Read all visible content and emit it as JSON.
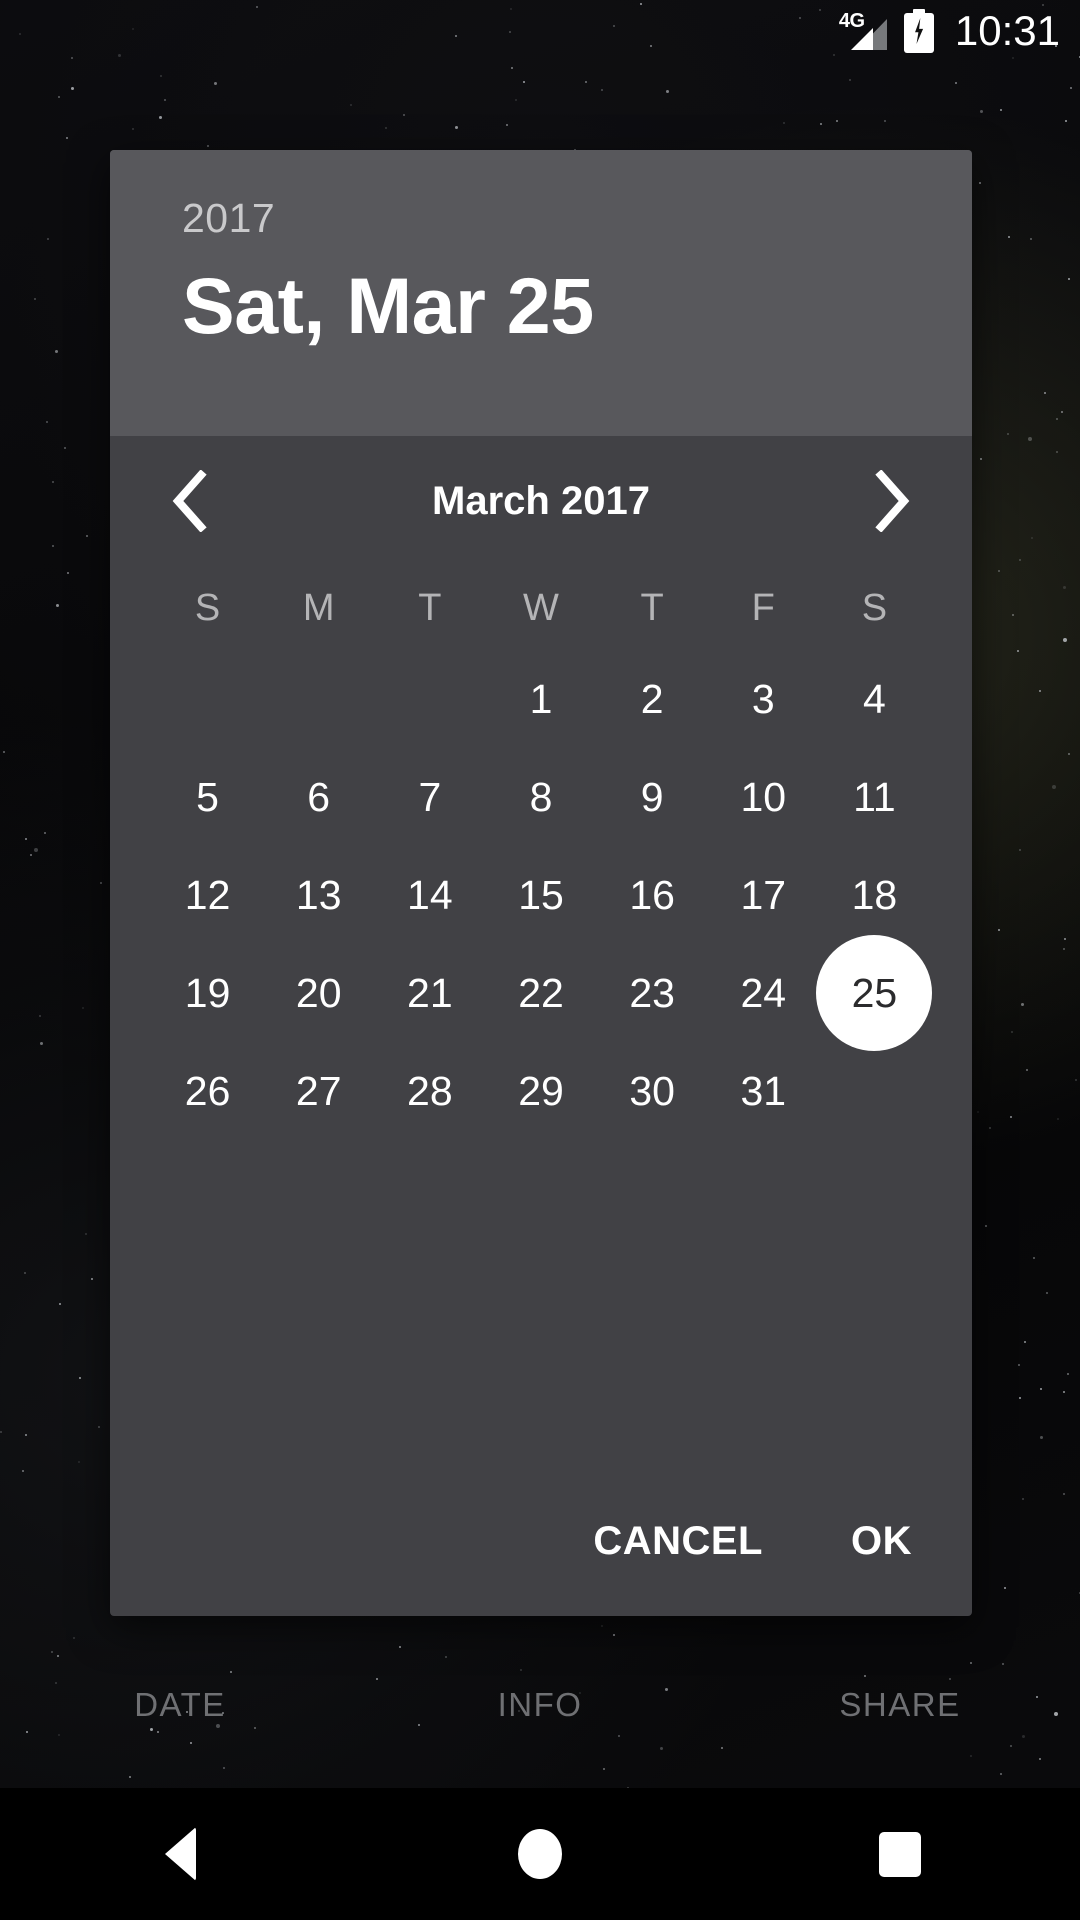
{
  "status_bar": {
    "network_label": "4G",
    "time": "10:31",
    "battery_icon": "battery-charging-icon",
    "signal_icon": "signal-bars-icon"
  },
  "dialog": {
    "header": {
      "year": "2017",
      "date_line": "Sat, Mar 25"
    },
    "month_nav": {
      "prev_icon": "chevron-left-icon",
      "next_icon": "chevron-right-icon",
      "month_label": "March 2017"
    },
    "weekday_headers": [
      "S",
      "M",
      "T",
      "W",
      "T",
      "F",
      "S"
    ],
    "weeks": [
      [
        "",
        "",
        "",
        "1",
        "2",
        "3",
        "4"
      ],
      [
        "5",
        "6",
        "7",
        "8",
        "9",
        "10",
        "11"
      ],
      [
        "12",
        "13",
        "14",
        "15",
        "16",
        "17",
        "18"
      ],
      [
        "19",
        "20",
        "21",
        "22",
        "23",
        "24",
        "25"
      ],
      [
        "26",
        "27",
        "28",
        "29",
        "30",
        "31",
        ""
      ]
    ],
    "selected_day": "25",
    "actions": {
      "cancel_label": "CANCEL",
      "ok_label": "OK"
    }
  },
  "bottom_tabs": [
    {
      "label": "DATE"
    },
    {
      "label": "INFO"
    },
    {
      "label": "SHARE"
    }
  ],
  "nav_bar": {
    "back_icon": "back-triangle-icon",
    "home_icon": "home-circle-icon",
    "recents_icon": "recents-square-icon"
  },
  "colors": {
    "dialog_body": "#414145",
    "dialog_header": "#58585c",
    "selected_circle": "#ffffff",
    "primary_text": "#ffffff",
    "muted_text": "#b4b4b6",
    "tab_text": "#6f7073"
  }
}
